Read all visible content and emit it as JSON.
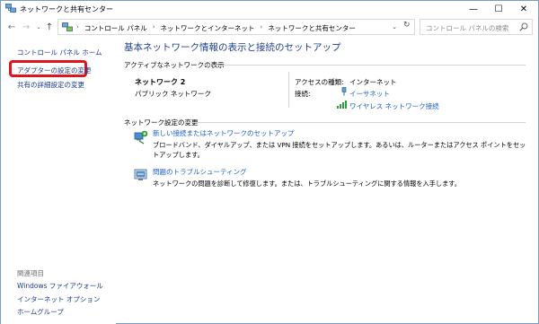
{
  "window": {
    "title": "ネットワークと共有センター",
    "controls": {
      "minimize": "—",
      "maximize": "☐",
      "close": "✕"
    }
  },
  "address_bar": {
    "breadcrumbs": [
      "コントロール パネル",
      "ネットワークとインターネット",
      "ネットワークと共有センター"
    ],
    "separator": "›",
    "search_placeholder": "コントロール パネルの検索"
  },
  "sidebar": {
    "home": "コントロール パネル ホーム",
    "adapter_settings": "アダプターの設定の変更",
    "advanced_sharing": "共有の詳細設定の変更",
    "related_heading": "関連項目",
    "related": [
      "Windows ファイアウォール",
      "インターネット オプション",
      "ホームグループ"
    ]
  },
  "main": {
    "title": "基本ネットワーク情報の表示と接続のセットアップ",
    "active_networks_heading": "アクティブなネットワークの表示",
    "network": {
      "name": "ネットワーク 2",
      "type": "パブリック ネットワーク",
      "access_type_label": "アクセスの種類:",
      "access_type_value": "インターネット",
      "connections_label": "接続:",
      "connection_1": "イーサネット",
      "connection_2": "ワイヤレス ネットワーク接続"
    },
    "settings_heading": "ネットワーク設定の変更",
    "tasks": [
      {
        "link": "新しい接続またはネットワークのセットアップ",
        "description": "ブロードバンド、ダイヤルアップ、または VPN 接続をセットアップします。あるいは、ルーターまたはアクセス ポイントをセットアップします。"
      },
      {
        "link": "問題のトラブルシューティング",
        "description": "ネットワークの問題を診断して修復します。または、トラブルシューティングに関する情報を入手します。"
      }
    ]
  },
  "colors": {
    "link": "#1a5ec8",
    "sidebar_link": "#1a3a8f",
    "title": "#1e3f8f",
    "highlight": "#e0141f"
  },
  "icons": {
    "app": "network-center-icon",
    "back": "back-arrow-icon",
    "forward": "forward-arrow-icon",
    "up": "up-arrow-icon",
    "refresh": "refresh-icon",
    "search": "search-icon",
    "ethernet": "ethernet-icon",
    "wifi": "wifi-signal-icon",
    "setup": "setup-connection-icon",
    "troubleshoot": "troubleshoot-icon"
  }
}
